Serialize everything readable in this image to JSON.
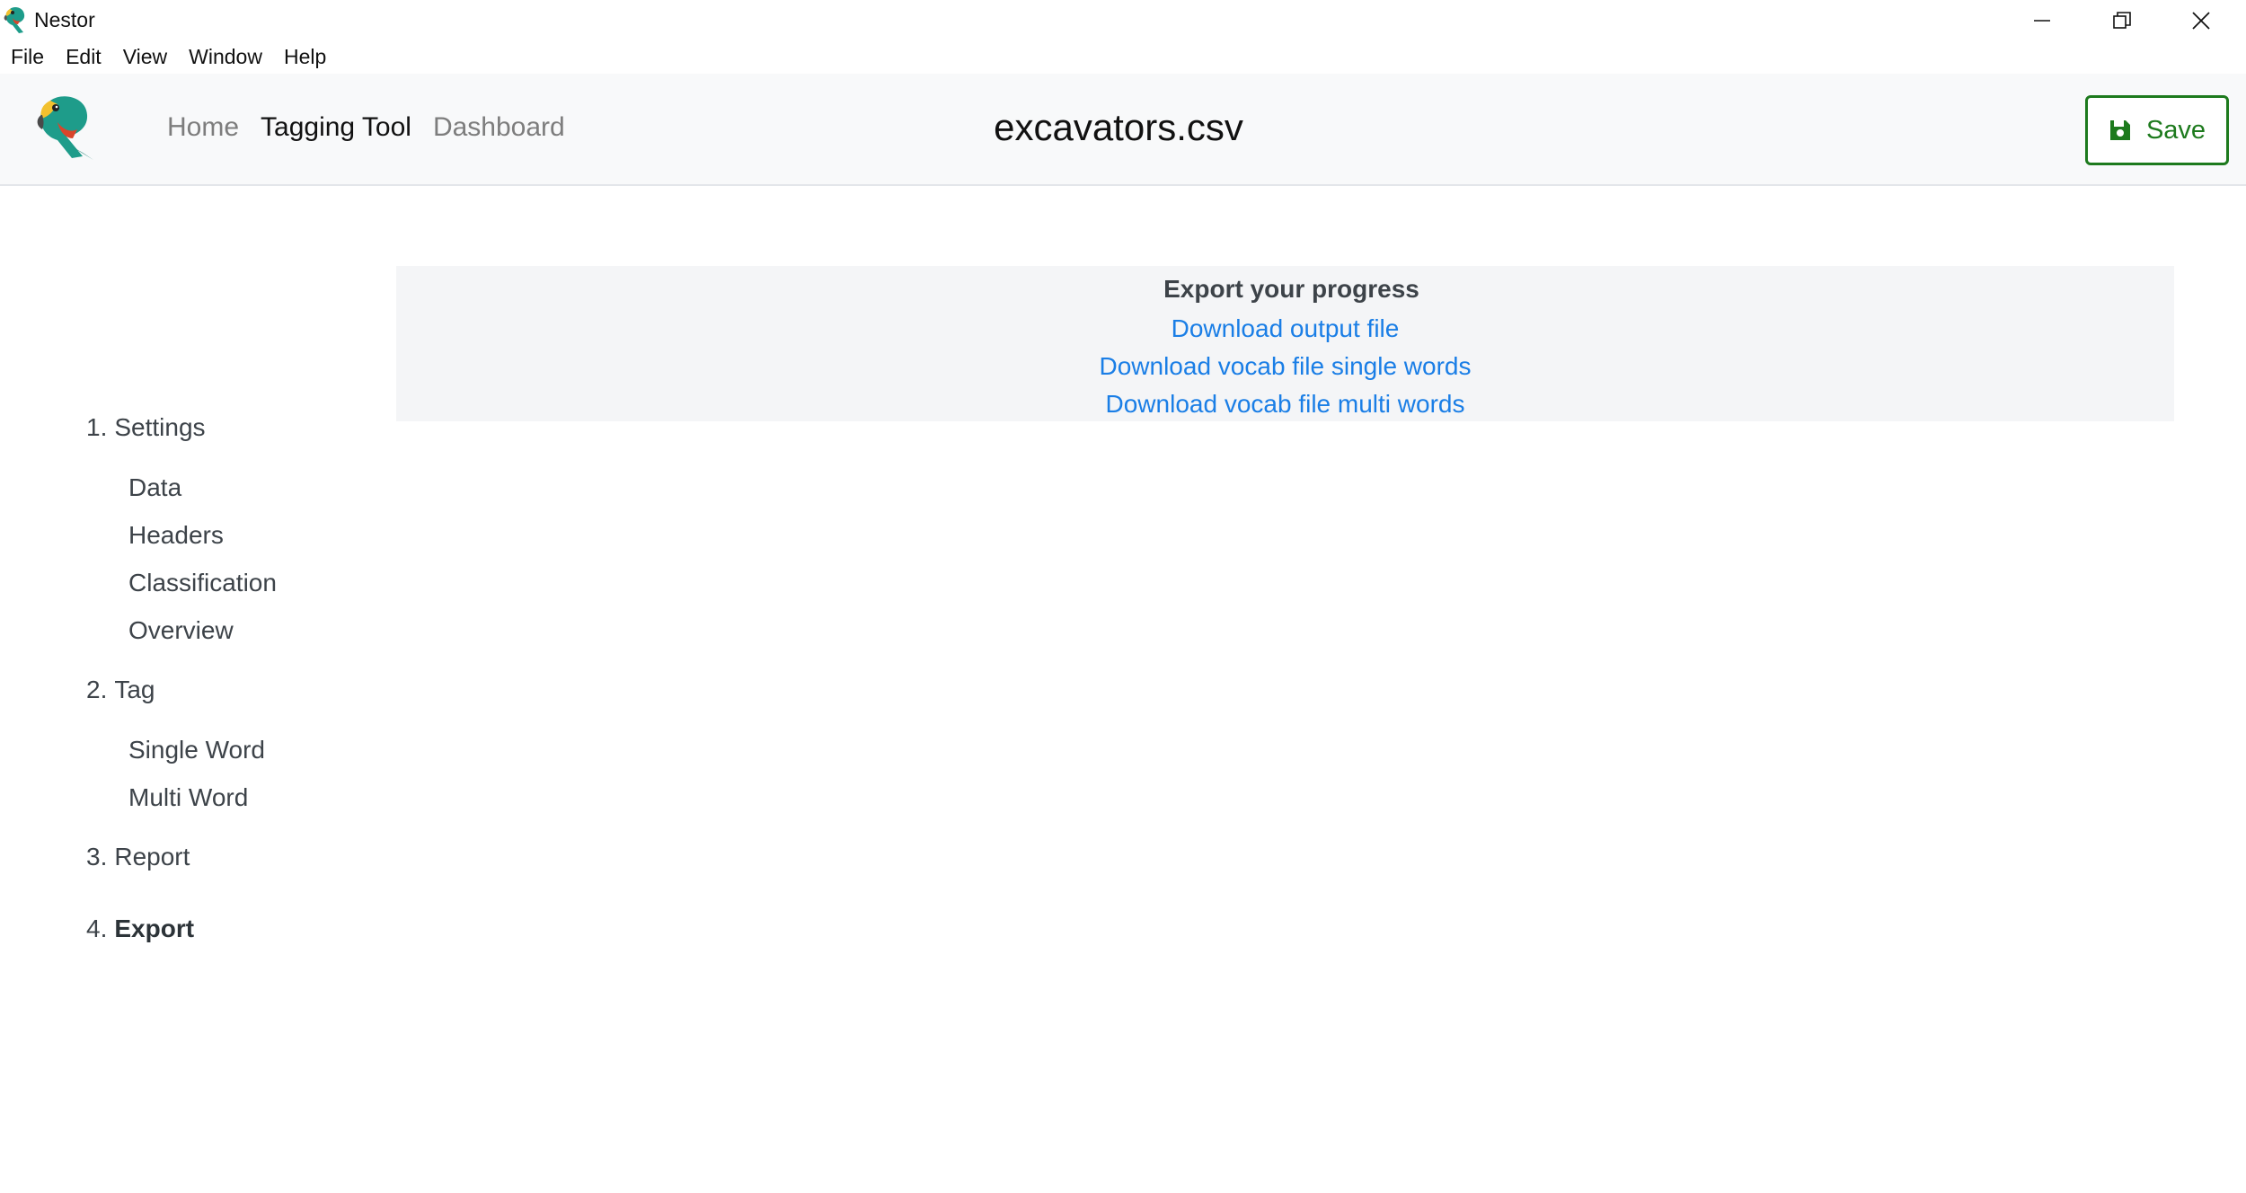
{
  "window": {
    "title": "Nestor",
    "app_icon": "parrot-icon",
    "controls": [
      "minimize-icon",
      "restore-icon",
      "close-icon"
    ]
  },
  "menu": {
    "items": [
      "File",
      "Edit",
      "View",
      "Window",
      "Help"
    ]
  },
  "header": {
    "logo": "parrot-logo",
    "nav": [
      {
        "label": "Home",
        "active": false
      },
      {
        "label": "Tagging Tool",
        "active": true
      },
      {
        "label": "Dashboard",
        "active": false
      }
    ],
    "file_name": "excavators.csv",
    "save_label": "Save",
    "save_icon": "floppy-disk-icon",
    "accent_color": "#1d7a1d"
  },
  "sidebar": {
    "steps": [
      {
        "num": "1.",
        "label": "Settings",
        "substeps": [
          "Data",
          "Headers",
          "Classification",
          "Overview"
        ]
      },
      {
        "num": "2.",
        "label": "Tag",
        "substeps": [
          "Single Word",
          "Multi Word"
        ]
      },
      {
        "num": "3.",
        "label": "Report",
        "substeps": []
      },
      {
        "num": "4.",
        "label": "Export",
        "substeps": [],
        "current": true
      }
    ]
  },
  "export": {
    "heading": "Export your progress",
    "links": [
      "Download output file",
      "Download vocab file single words",
      "Download vocab file multi words"
    ],
    "link_color": "#1a7ee6"
  }
}
